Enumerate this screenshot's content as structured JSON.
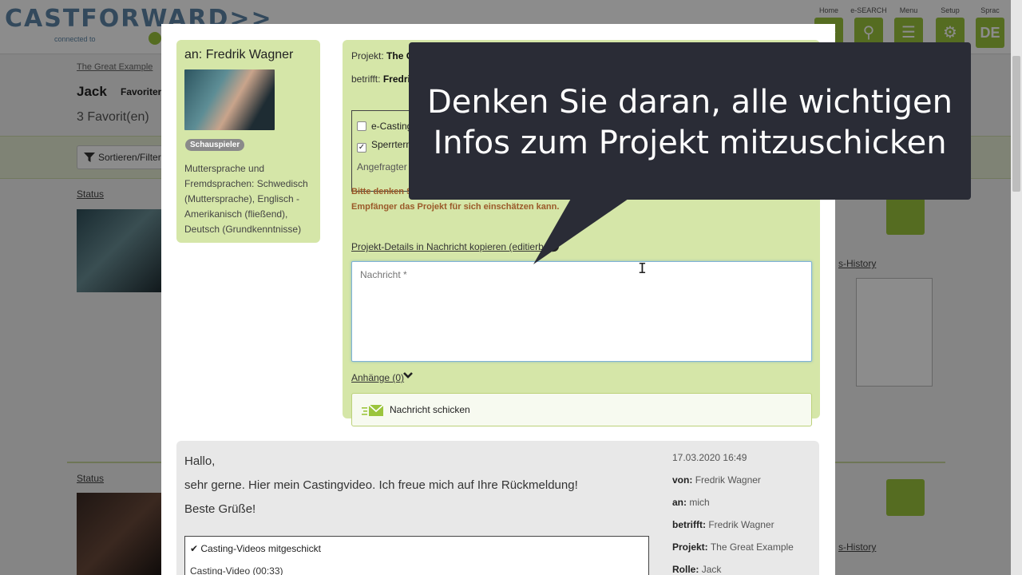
{
  "background": {
    "logo": "CASTFORWARD>>",
    "logo_sub": "connected to",
    "nav": [
      {
        "label": "Home",
        "icon": "home-icon",
        "glyph": ""
      },
      {
        "label": "e-SEARCH",
        "icon": "search-icon",
        "glyph": "⚲"
      },
      {
        "label": "Menu",
        "icon": "menu-icon",
        "glyph": "☰"
      },
      {
        "label": "Setup",
        "icon": "gear-icon",
        "glyph": "⚙"
      },
      {
        "label": "Sprac",
        "icon": "language-icon",
        "glyph": "DE"
      }
    ],
    "breadcrumb": "The Great Example",
    "title": "Jack",
    "favorites_tab": "Favoriten",
    "count": "3 Favorit(en)",
    "sort_button": "Sortieren/Filter",
    "status_label": "Status",
    "history_link": "s-History"
  },
  "modal": {
    "recipient": "an: Fredrik Wagner",
    "role_badge": "Schauspieler",
    "languages": "Muttersprache und Fremdsprachen: Schwedisch (Muttersprache), Englisch - Amerikanisch (fließend), Deutsch (Grundkenntnisse)",
    "project_label": "Projekt:",
    "project_value": "The G",
    "concerns_label": "betrifft:",
    "concerns_value": "Fredri",
    "option_ecasting": "e-Casting",
    "option_ecasting_checked": false,
    "option_block": "Sperrterm",
    "option_block_checked": true,
    "requested_label": "Angefragter Z",
    "warning_1": "Bitte denken S",
    "warning_2": "Empfänger das Projekt für sich einschätzen kann.",
    "copy_details_link": "Projekt-Details in Nachricht kopieren (editierbar)",
    "message_placeholder": "Nachricht *",
    "attachments_link": "Anhänge (0)",
    "send_button": "Nachricht schicken"
  },
  "history": {
    "greeting": "Hallo,",
    "body": "sehr gerne. Hier mein Castingvideo. Ich freue mich auf Ihre Rückmeldung!",
    "closing": "Beste Grüße!",
    "box_title": "✔ Casting-Videos mitgeschickt",
    "box_item": "Casting-Video (00:33)",
    "date": "17.03.2020 16:49",
    "from_label": "von:",
    "from_value": "Fredrik Wagner",
    "to_label": "an:",
    "to_value": "mich",
    "concerns_label": "betrifft:",
    "concerns_value": "Fredrik Wagner",
    "project_label": "Projekt:",
    "project_value": "The Great Example",
    "role_label": "Rolle:",
    "role_value": "Jack"
  },
  "callout": {
    "line1": "Denken Sie daran, alle wichtigen",
    "line2": "Infos zum Projekt mitzuschicken"
  },
  "colors": {
    "accent_green": "#9bc53d",
    "panel_green": "#d5e6a8",
    "callout_bg": "#2a2c36",
    "warning_text": "#9b5a2a"
  }
}
